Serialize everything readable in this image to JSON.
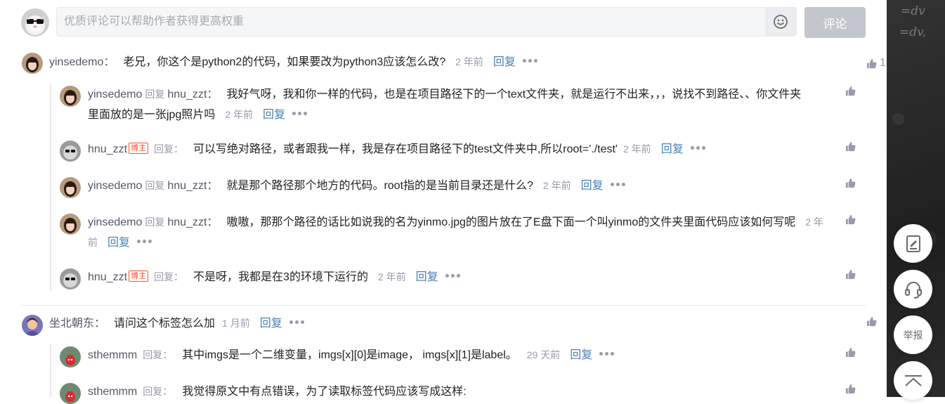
{
  "input": {
    "placeholder": "优质评论可以帮助作者获得更高权重",
    "submit_label": "评论"
  },
  "common": {
    "reply_label": "回复",
    "reply_label_colon": "回复：",
    "blogger_tag": "博主"
  },
  "comments": [
    {
      "user": "yinsedemo",
      "text": "老兄，你这个是python2的代码，如果要改为python3应该怎么改?",
      "time": "2 年前",
      "likes": "1",
      "replies": [
        {
          "user": "yinsedemo",
          "target": "hnu_zzt",
          "text": "我好气呀，我和你一样的代码，也是在项目路径下的一个text文件夹，就是运行不出来，，，说找不到路径、、你文件夹里面放的是一张jpg照片吗",
          "time": "2 年前"
        },
        {
          "user": "hnu_zzt",
          "blogger": true,
          "text": "可以写绝对路径，或者跟我一样，我是存在项目路径下的test文件夹中,所以root='./test'",
          "time": "2 年前"
        },
        {
          "user": "yinsedemo",
          "target": "hnu_zzt",
          "text": "就是那个路径那个地方的代码。root指的是当前目录还是什么?",
          "time": "2 年前"
        },
        {
          "user": "yinsedemo",
          "target": "hnu_zzt",
          "text": "嗷嗷，那那个路径的话比如说我的名为yinmo.jpg的图片放在了E盘下面一个叫yinmo的文件夹里面代码应该如何写呢",
          "time": "2 年前"
        },
        {
          "user": "hnu_zzt",
          "blogger": true,
          "text": "不是呀，我都是在3的环境下运行的",
          "time": "2 年前"
        }
      ]
    },
    {
      "user": "坐北朝东",
      "text": "请问这个标签怎么加",
      "time": "1 月前",
      "replies": [
        {
          "user": "sthemmm",
          "text": "其中imgs是一个二维变量，imgs[x][0]是image， imgs[x][1]是label。",
          "time": "29 天前"
        },
        {
          "user": "sthemmm",
          "text": "我觉得原文中有点错误，为了读取标签代码应该写成这样:",
          "time": ""
        }
      ]
    }
  ],
  "tools": {
    "report_label": "举报"
  },
  "side": {
    "chalk1": "=dv",
    "chalk2": "=dv,"
  }
}
